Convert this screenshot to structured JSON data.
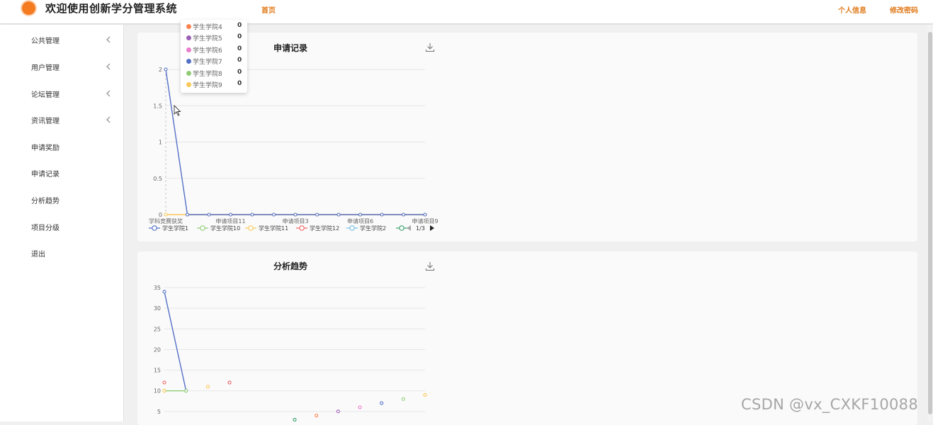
{
  "header": {
    "title": "欢迎使用创新学分管理系统",
    "home_label": "首页",
    "profile_label": "个人信息",
    "password_label": "修改密码"
  },
  "sidebar": {
    "items": [
      {
        "label": "公共管理",
        "has_chevron": true
      },
      {
        "label": "用户管理",
        "has_chevron": true
      },
      {
        "label": "论坛管理",
        "has_chevron": true
      },
      {
        "label": "资讯管理",
        "has_chevron": true
      },
      {
        "label": "申请奖励",
        "has_chevron": false
      },
      {
        "label": "申请记录",
        "has_chevron": false
      },
      {
        "label": "分析趋势",
        "has_chevron": false
      },
      {
        "label": "项目分级",
        "has_chevron": false
      },
      {
        "label": "退出",
        "has_chevron": false
      }
    ]
  },
  "colors": {
    "accent": "#e07a1a",
    "palette": [
      "#5470c6",
      "#91cc75",
      "#fac858",
      "#ee6666",
      "#73c0de",
      "#3ba272",
      "#fc8452",
      "#9a60b4",
      "#ea7ccc"
    ]
  },
  "tooltip": {
    "rows": [
      {
        "name": "学生学院4",
        "value": "0",
        "color": "#fc8452"
      },
      {
        "name": "学生学院5",
        "value": "0",
        "color": "#9a60b4"
      },
      {
        "name": "学生学院6",
        "value": "0",
        "color": "#ea7ccc"
      },
      {
        "name": "学生学院7",
        "value": "0",
        "color": "#5470c6"
      },
      {
        "name": "学生学院8",
        "value": "0",
        "color": "#91cc75"
      },
      {
        "name": "学生学院9",
        "value": "0",
        "color": "#fac858"
      }
    ]
  },
  "chart_data": [
    {
      "type": "line",
      "title": "申请记录",
      "ylim": [
        0,
        2
      ],
      "yticks": [
        "0",
        "0.5",
        "1",
        "1.5",
        "2"
      ],
      "x_count": 13,
      "x_tick_labels": [
        {
          "i": 0,
          "label": "学科竞赛获奖"
        },
        {
          "i": 3,
          "label": "申请项目11"
        },
        {
          "i": 6,
          "label": "申请项目3"
        },
        {
          "i": 9,
          "label": "申请项目6"
        },
        {
          "i": 12,
          "label": "申请项目9"
        }
      ],
      "series": [
        {
          "color": "#fac858",
          "values": [
            0,
            0,
            0,
            0,
            0,
            0,
            0,
            0,
            0,
            0,
            0,
            0,
            0
          ]
        },
        {
          "color": "#5470c6",
          "values": [
            2,
            0,
            0,
            0,
            0,
            0,
            0,
            0,
            0,
            0,
            0,
            0,
            0
          ]
        }
      ],
      "legend": {
        "items": [
          {
            "name": "学生学院1",
            "color": "#5470c6"
          },
          {
            "name": "学生学院10",
            "color": "#91cc75"
          },
          {
            "name": "学生学院11",
            "color": "#fac858"
          },
          {
            "name": "学生学院12",
            "color": "#ee6666"
          },
          {
            "name": "学生学院2",
            "color": "#73c0de"
          }
        ],
        "extra_color": "#3ba272",
        "page": "1/3"
      }
    },
    {
      "type": "line",
      "title": "分析趋势",
      "ylim": [
        0,
        35
      ],
      "yticks": [
        "5",
        "10",
        "15",
        "20",
        "25",
        "30",
        "35"
      ],
      "x_count": 13,
      "series": [
        {
          "color": "#5470c6",
          "values": [
            34,
            10,
            null,
            12,
            null,
            null,
            null,
            null,
            null,
            null,
            7,
            null,
            null
          ]
        },
        {
          "color": "#91cc75",
          "values": [
            10,
            10,
            null,
            null,
            null,
            null,
            3,
            null,
            null,
            null,
            null,
            8,
            null
          ]
        },
        {
          "color": "#fac858",
          "values": [
            10,
            null,
            11,
            null,
            null,
            null,
            null,
            null,
            null,
            null,
            null,
            null,
            9
          ]
        },
        {
          "color": "#ee6666",
          "values": [
            12,
            null,
            null,
            12,
            null,
            null,
            null,
            null,
            null,
            null,
            null,
            null,
            null
          ]
        },
        {
          "color": "#fc8452",
          "values": [
            null,
            null,
            null,
            null,
            null,
            null,
            null,
            4,
            null,
            null,
            null,
            null,
            null
          ]
        },
        {
          "color": "#9a60b4",
          "values": [
            null,
            null,
            null,
            null,
            null,
            null,
            null,
            null,
            5,
            null,
            null,
            null,
            null
          ]
        },
        {
          "color": "#ea7ccc",
          "values": [
            null,
            null,
            null,
            null,
            null,
            null,
            null,
            null,
            null,
            6,
            null,
            null,
            null
          ]
        },
        {
          "color": "#3ba272",
          "values": [
            null,
            null,
            null,
            null,
            null,
            null,
            3,
            null,
            null,
            null,
            null,
            null,
            null
          ]
        }
      ]
    }
  ],
  "watermark": "CSDN @vx_CXKF10088"
}
